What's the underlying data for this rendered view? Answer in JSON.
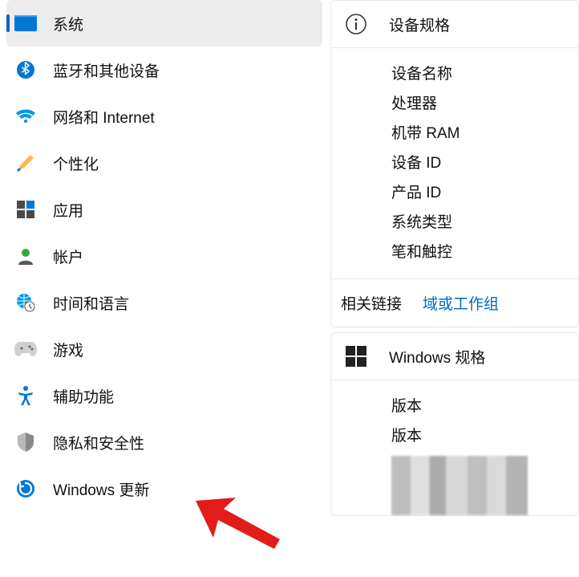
{
  "sidebar": {
    "items": [
      {
        "label": "系统"
      },
      {
        "label": "蓝牙和其他设备"
      },
      {
        "label": "网络和 Internet"
      },
      {
        "label": "个性化"
      },
      {
        "label": "应用"
      },
      {
        "label": "帐户"
      },
      {
        "label": "时间和语言"
      },
      {
        "label": "游戏"
      },
      {
        "label": "辅助功能"
      },
      {
        "label": "隐私和安全性"
      },
      {
        "label": "Windows 更新"
      }
    ]
  },
  "deviceSpec": {
    "title": "设备规格",
    "rows": [
      "设备名称",
      "处理器",
      "机带 RAM",
      "设备 ID",
      "产品 ID",
      "系统类型",
      "笔和触控"
    ]
  },
  "related": {
    "label": "相关链接",
    "link": "域或工作组"
  },
  "winSpec": {
    "title": "Windows 规格",
    "rows": [
      "版本",
      "版本"
    ]
  }
}
